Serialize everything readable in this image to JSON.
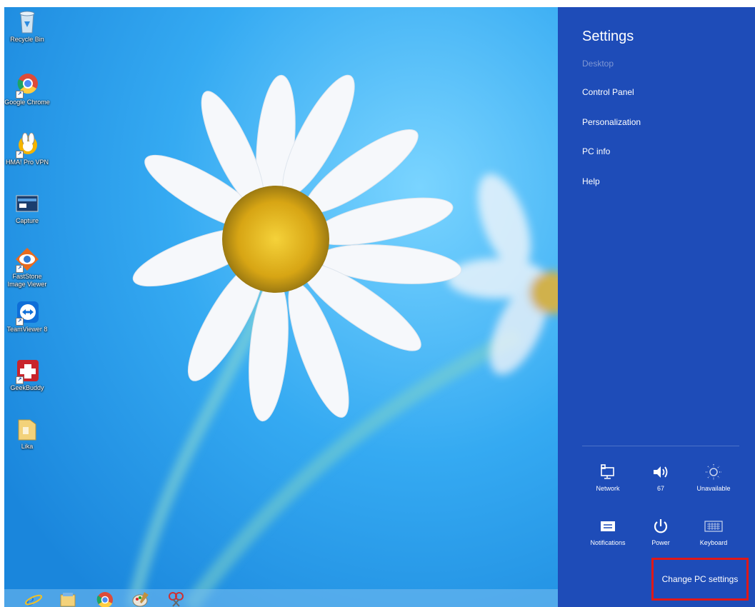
{
  "desktop": {
    "icons": [
      {
        "label": "Recycle Bin",
        "icon": "recycle-bin-icon"
      },
      {
        "label": "Google Chrome",
        "icon": "chrome-icon"
      },
      {
        "label": "HMA! Pro VPN",
        "icon": "hma-vpn-icon"
      },
      {
        "label": "Capture",
        "icon": "capture-icon"
      },
      {
        "label": "FastStone Image Viewer",
        "icon": "faststone-icon"
      },
      {
        "label": "TeamViewer 8",
        "icon": "teamviewer-icon"
      },
      {
        "label": "GeekBuddy",
        "icon": "geekbuddy-icon"
      },
      {
        "label": "Lika",
        "icon": "folder-icon"
      }
    ]
  },
  "taskbar": {
    "items": [
      "internet-explorer-icon",
      "file-explorer-icon",
      "chrome-icon",
      "paint-icon",
      "snipping-tool-icon"
    ]
  },
  "charm": {
    "title": "Settings",
    "context": "Desktop",
    "links": [
      "Control Panel",
      "Personalization",
      "PC info",
      "Help"
    ],
    "quick_settings": [
      {
        "label": "Network",
        "icon": "network-icon"
      },
      {
        "label": "67",
        "icon": "volume-icon"
      },
      {
        "label": "Unavailable",
        "icon": "brightness-icon"
      },
      {
        "label": "Notifications",
        "icon": "notifications-icon"
      },
      {
        "label": "Power",
        "icon": "power-icon"
      },
      {
        "label": "Keyboard",
        "icon": "keyboard-icon"
      }
    ],
    "change_pc_settings": "Change PC settings"
  },
  "colors": {
    "charm_bg": "#1e4cb8",
    "highlight_box": "#e01818",
    "desktop_sky": "#2ea6f1"
  }
}
